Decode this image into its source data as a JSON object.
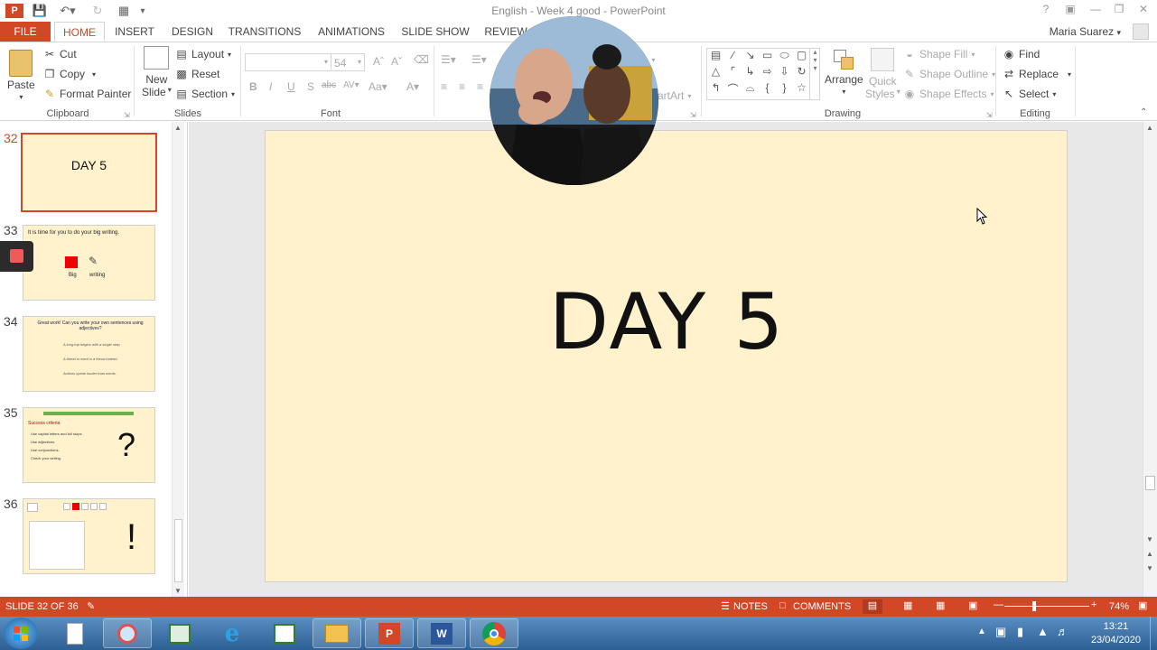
{
  "window": {
    "title": "English - Week 4 good - PowerPoint",
    "user": "Maria Suarez"
  },
  "tabs": [
    "FILE",
    "HOME",
    "INSERT",
    "DESIGN",
    "TRANSITIONS",
    "ANIMATIONS",
    "SLIDE SHOW",
    "REVIEW"
  ],
  "ribbon": {
    "clipboard": {
      "label": "Clipboard",
      "paste": "Paste",
      "cut": "Cut",
      "copy": "Copy",
      "format_painter": "Format Painter"
    },
    "slides": {
      "label": "Slides",
      "new_slide_1": "New",
      "new_slide_2": "Slide",
      "layout": "Layout",
      "reset": "Reset",
      "section": "Section"
    },
    "font": {
      "label": "Font",
      "font_size": "54"
    },
    "paragraph_partial": {
      "align": "on",
      "smartart": "artArt"
    },
    "drawing": {
      "label": "Drawing",
      "arrange": "Arrange",
      "quick_styles_1": "Quick",
      "quick_styles_2": "Styles",
      "shape_fill": "Shape Fill",
      "shape_outline": "Shape Outline",
      "shape_effects": "Shape Effects"
    },
    "editing": {
      "label": "Editing",
      "find": "Find",
      "replace": "Replace",
      "select": "Select"
    }
  },
  "thumbnails": [
    {
      "num": "32",
      "text": "DAY 5",
      "selected": true
    },
    {
      "num": "33",
      "text": "It is time for you to do your big writing.",
      "cap1": "Big",
      "cap2": "writing"
    },
    {
      "num": "34",
      "text": "Great work! Can you write your own sentences using adjectives?",
      "line1": "A long trip begins with a single step.",
      "line2": "A friend in need is a friend indeed.",
      "line3": "Actions speak louder than words."
    },
    {
      "num": "35",
      "text": "?",
      "heading": "Success criteria",
      "bullets": [
        "Use capital letters and full stops.",
        "Use adjectives.",
        "Use conjunctions.",
        "Check your writing."
      ]
    },
    {
      "num": "36",
      "text": "!"
    }
  ],
  "slide": {
    "title": "DAY 5"
  },
  "status": {
    "slide_info": "SLIDE 32 OF 36",
    "notes": "NOTES",
    "comments": "COMMENTS",
    "zoom": "74%"
  },
  "taskbar": {
    "clock_time": "13:21",
    "clock_date": "23/04/2020"
  },
  "colors": {
    "accent": "#d24726",
    "slide_bg": "#fff2cc",
    "taskbar": "#2c5f93"
  }
}
